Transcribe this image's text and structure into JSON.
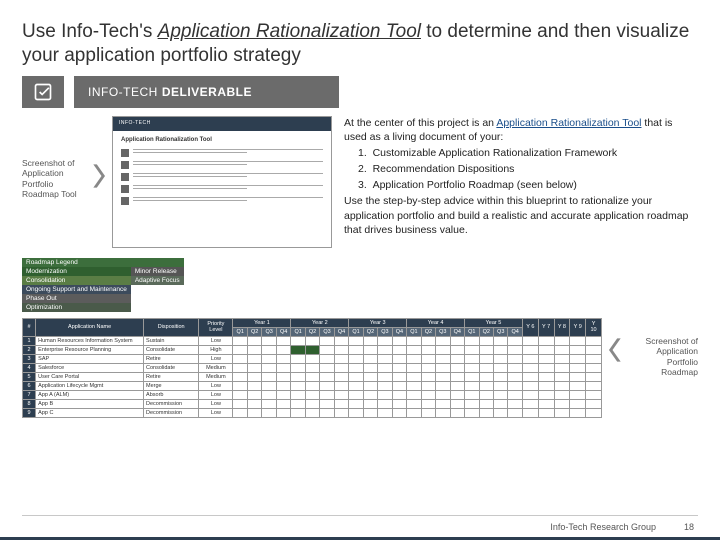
{
  "header": {
    "title_pre": "Use Info-Tech's ",
    "title_underline": "Application Rationalization Tool",
    "title_post": " to determine and then visualize your application portfolio strategy"
  },
  "deliverable": {
    "label_a": "INFO-TECH",
    "label_b": "DELIVERABLE"
  },
  "left_caption": "Screenshot of Application Portfolio Roadmap Tool",
  "thumb": {
    "brand": "INFO-TECH",
    "title": "Application Rationalization Tool"
  },
  "right_text": {
    "intro_a": "At the center of this project is an ",
    "link": "Application Rationalization Tool",
    "intro_b": " that is used as a living document of your:",
    "items": [
      "Customizable Application Rationalization Framework",
      "Recommendation Dispositions",
      "Application Portfolio Roadmap (seen below)"
    ],
    "closing": "Use the step-by-step advice within this blueprint to rationalize your application portfolio and build a realistic and accurate application roadmap that drives business value."
  },
  "legend": {
    "title": "Roadmap Legend",
    "rows": [
      [
        "Modernization",
        "Minor Release"
      ],
      [
        "Consolidation",
        "Adaptive Focus"
      ],
      [
        "Ongoing Support and Maintenance",
        ""
      ],
      [
        "Phase Out",
        ""
      ],
      [
        "Optimization",
        ""
      ]
    ]
  },
  "roadmap": {
    "years": [
      "Year 1",
      "Year 2",
      "Year 3",
      "Year 4",
      "Year 5"
    ],
    "short_years": [
      "Y 6",
      "Y 7",
      "Y 8",
      "Y 9",
      "Y 10"
    ],
    "quarters": [
      "Q1",
      "Q2",
      "Q3",
      "Q4"
    ],
    "cols": {
      "num": "#",
      "app": "Application Name",
      "disp": "Disposition",
      "pri": "Priority Level"
    },
    "rows": [
      {
        "n": "1",
        "app": "Human Resources Information System",
        "disp": "Sustain",
        "pri": "Low",
        "fill": []
      },
      {
        "n": "2",
        "app": "Enterprise Resource Planning",
        "disp": "Consolidate",
        "pri": "High",
        "fill": [
          4,
          5
        ]
      },
      {
        "n": "3",
        "app": "SAP",
        "disp": "Retire",
        "pri": "Low",
        "fill": []
      },
      {
        "n": "4",
        "app": "Salesforce",
        "disp": "Consolidate",
        "pri": "Medium",
        "fill": []
      },
      {
        "n": "5",
        "app": "User Care Portal",
        "disp": "Retire",
        "pri": "Medium",
        "fill": []
      },
      {
        "n": "6",
        "app": "Application Lifecycle Mgmt",
        "disp": "Merge",
        "pri": "Low",
        "fill": []
      },
      {
        "n": "7",
        "app": "App A (ALM)",
        "disp": "Absorb",
        "pri": "Low",
        "fill": []
      },
      {
        "n": "8",
        "app": "App B",
        "disp": "Decommission",
        "pri": "Low",
        "fill": []
      },
      {
        "n": "9",
        "app": "App C",
        "disp": "Decommission",
        "pri": "Low",
        "fill": []
      }
    ],
    "caption": "Screenshot of Application Portfolio Roadmap"
  },
  "footer": {
    "org": "Info-Tech Research Group",
    "page": "18"
  }
}
